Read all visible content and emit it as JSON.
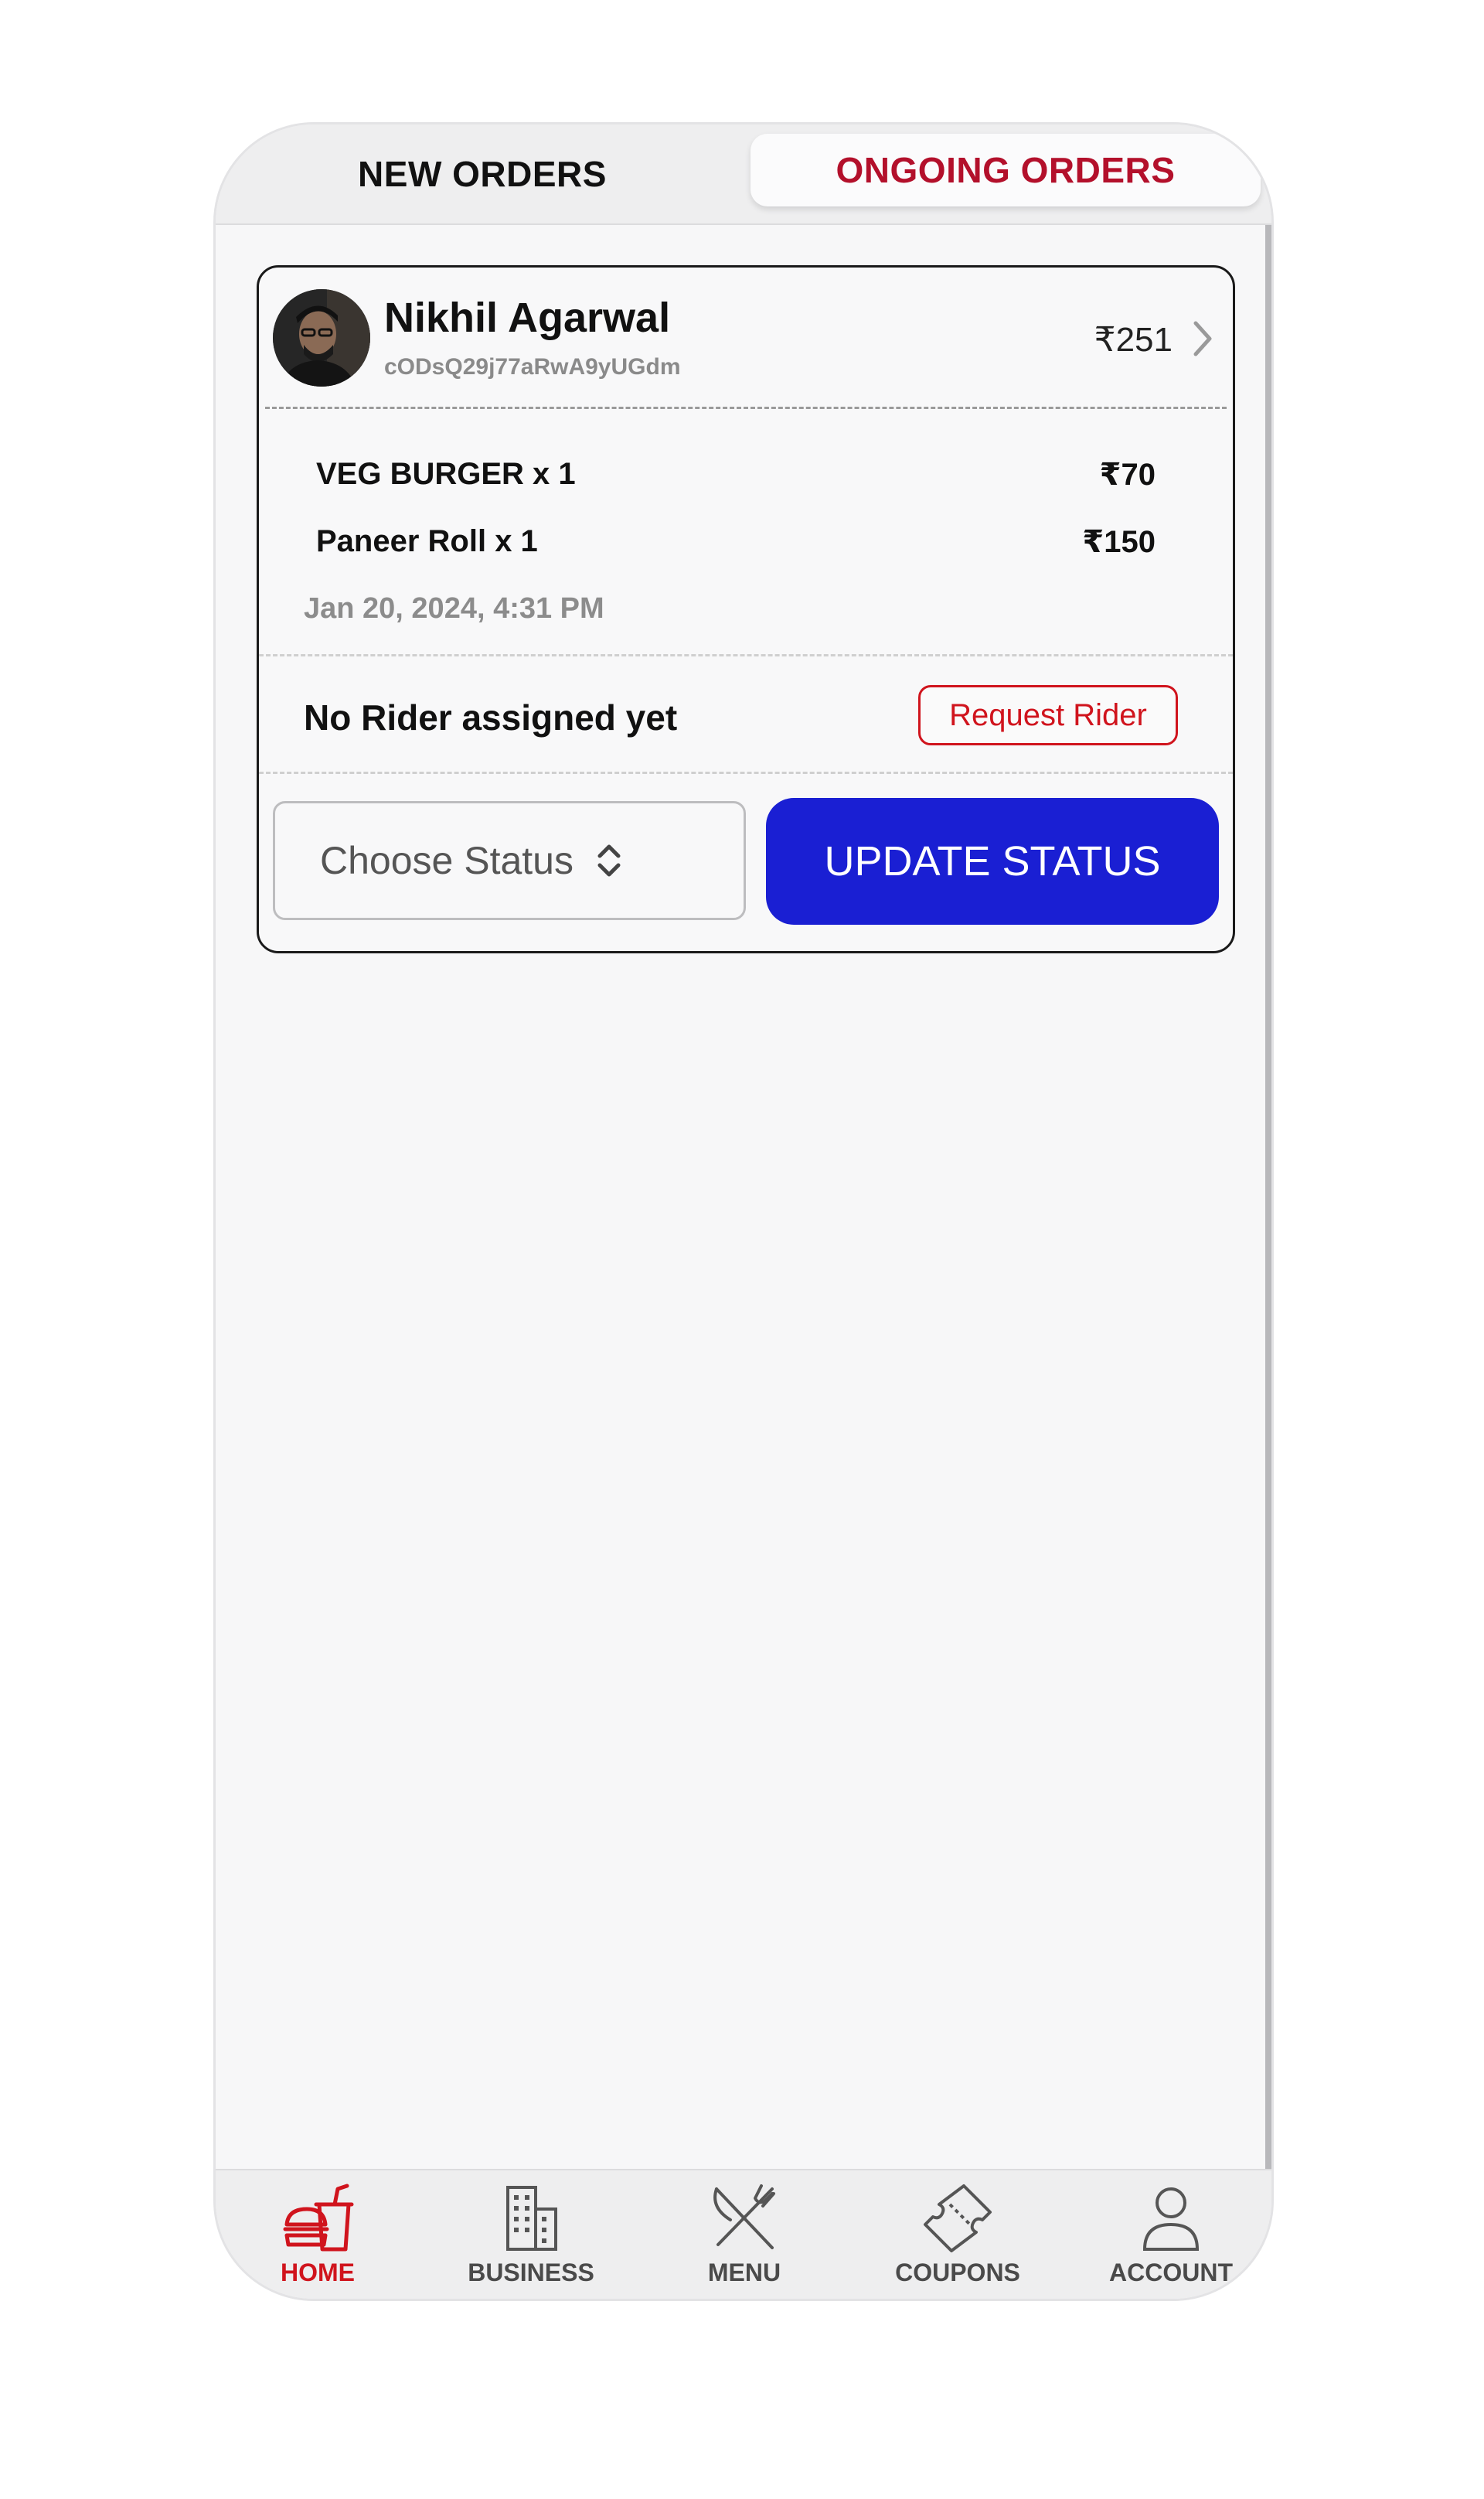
{
  "tabs": {
    "new_orders": "NEW ORDERS",
    "ongoing_orders": "ONGOING ORDERS",
    "active": "ongoing_orders"
  },
  "order": {
    "customer_name": "Nikhil Agarwal",
    "customer_id": "cODsQ29j77aRwA9yUGdm",
    "total": "₹251",
    "items": [
      {
        "name": "VEG BURGER x 1",
        "price": "₹70"
      },
      {
        "name": "Paneer Roll x 1",
        "price": "₹150"
      }
    ],
    "date": "Jan 20, 2024, 4:31 PM",
    "rider_status": "No Rider assigned yet",
    "request_rider_label": "Request Rider",
    "status_placeholder": "Choose Status",
    "update_status_label": "UPDATE STATUS"
  },
  "bottom_nav": [
    {
      "label": "HOME",
      "icon": "fast-food-icon",
      "active": true
    },
    {
      "label": "BUSINESS",
      "icon": "building-icon",
      "active": false
    },
    {
      "label": "MENU",
      "icon": "fork-knife-icon",
      "active": false
    },
    {
      "label": "COUPONS",
      "icon": "ticket-icon",
      "active": false
    },
    {
      "label": "ACCOUNT",
      "icon": "user-icon",
      "active": false
    }
  ],
  "colors": {
    "accent_red": "#d0141d",
    "tab_active": "#b3102b",
    "primary_button": "#1a1fd3"
  }
}
